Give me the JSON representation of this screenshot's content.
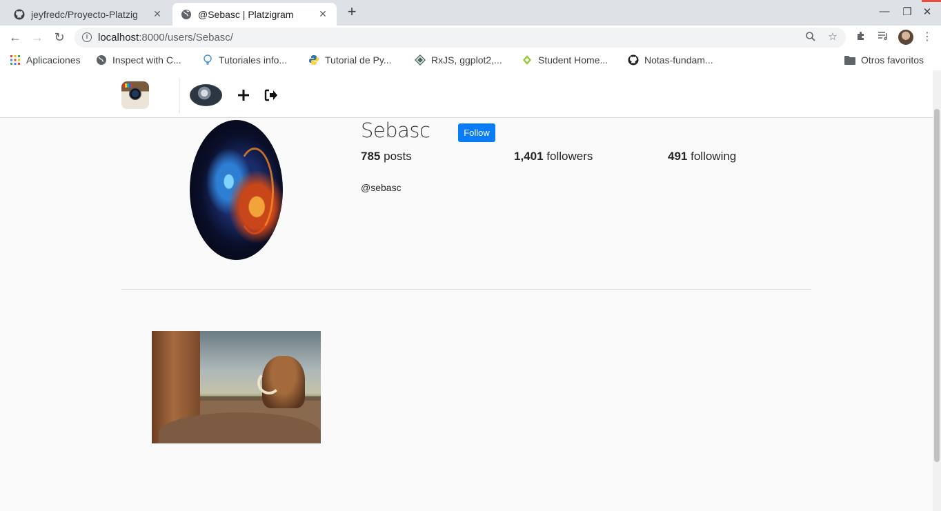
{
  "browser": {
    "tabs": [
      {
        "title": "jeyfredc/Proyecto-Platzig",
        "icon": "github-icon",
        "active": false
      },
      {
        "title": "@Sebasc | Platzigram",
        "icon": "globe-icon",
        "active": true
      }
    ],
    "url_host": "localhost",
    "url_rest": ":8000/users/Sebasc/",
    "bookmarks": [
      {
        "label": "Aplicaciones",
        "icon": "apps-grid-icon"
      },
      {
        "label": "Inspect with C...",
        "icon": "globe-icon"
      },
      {
        "label": "Tutoriales info...",
        "icon": "bulb-icon"
      },
      {
        "label": "Tutorial de Py...",
        "icon": "python-icon"
      },
      {
        "label": "RxJS, ggplot2,...",
        "icon": "diamond-icon"
      },
      {
        "label": "Student Home...",
        "icon": "leaf-icon"
      },
      {
        "label": "Notas-fundam...",
        "icon": "github-icon"
      },
      {
        "label": "Otros favoritos",
        "icon": "folder-icon"
      }
    ]
  },
  "profile": {
    "username": "Sebasc",
    "follow_label": "Follow",
    "posts_count": "785",
    "posts_label": "posts",
    "followers_count": "1,401",
    "followers_label": "followers",
    "following_count": "491",
    "following_label": "following",
    "handle": "@sebasc"
  },
  "colors": {
    "follow_button": "#0a7cf8",
    "divider": "#dbdbdb"
  }
}
